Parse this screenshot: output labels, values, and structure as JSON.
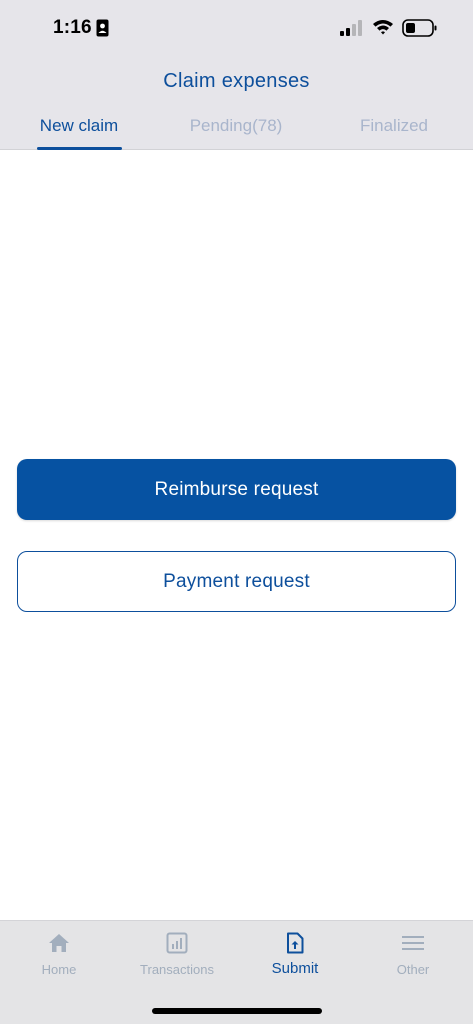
{
  "status_bar": {
    "time": "1:16",
    "icons": [
      "id-card-icon",
      "cellular-signal-icon",
      "wifi-icon",
      "battery-icon"
    ]
  },
  "header": {
    "title": "Claim expenses"
  },
  "tabs": [
    {
      "label": "New claim",
      "active": true
    },
    {
      "label": "Pending(78)",
      "active": false
    },
    {
      "label": "Finalized",
      "active": false
    }
  ],
  "actions": {
    "reimburse_label": "Reimburse request",
    "payment_label": "Payment request"
  },
  "tabbar": [
    {
      "label": "Home",
      "icon": "home-icon",
      "active": false
    },
    {
      "label": "Transactions",
      "icon": "chart-icon",
      "active": false
    },
    {
      "label": "Submit",
      "icon": "upload-document-icon",
      "active": true
    },
    {
      "label": "Other",
      "icon": "menu-icon",
      "active": false
    }
  ],
  "colors": {
    "brand": "#0d4f9c",
    "primary_button": "#0652a2",
    "inactive_tab": "#a9b5cc",
    "header_bg": "#e6e5ea",
    "tabbar_bg": "#e4e4e6"
  }
}
